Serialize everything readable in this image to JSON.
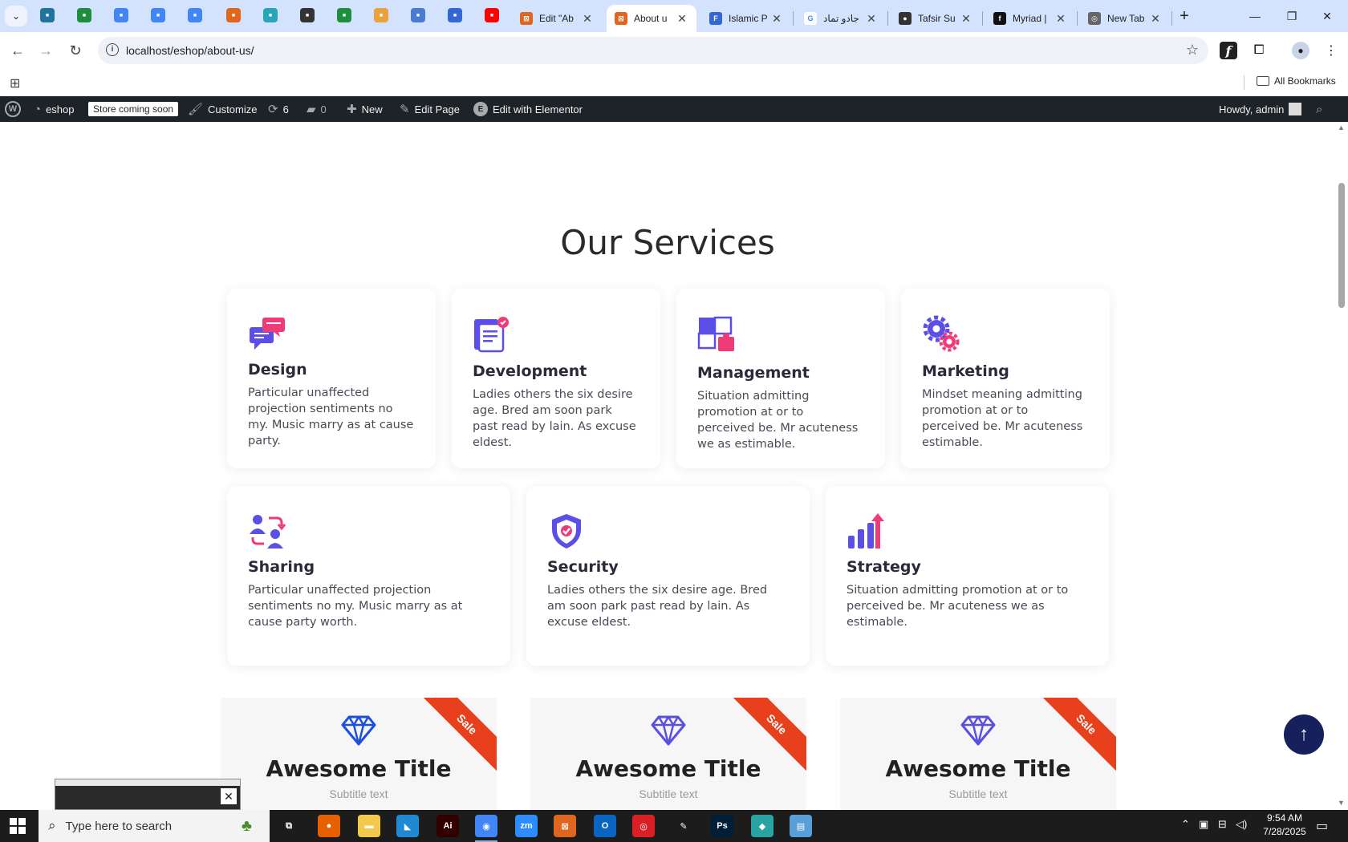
{
  "browser": {
    "tabs": [
      {
        "title": "Edit \"Ab",
        "favicon_color": "#e0661f",
        "favicon_glyph": "⊠",
        "active": false
      },
      {
        "title": "About u",
        "favicon_color": "#e0661f",
        "favicon_glyph": "⊠",
        "active": true
      },
      {
        "title": "Islamic P",
        "favicon_color": "#3367d6",
        "favicon_glyph": "F",
        "active": false
      },
      {
        "title": "جادو تماد",
        "favicon_color": "#ffffff",
        "favicon_glyph": "G",
        "active": false
      },
      {
        "title": "Tafsir Su",
        "favicon_color": "#333333",
        "favicon_glyph": "●",
        "active": false
      },
      {
        "title": "Myriad |",
        "favicon_color": "#111111",
        "favicon_glyph": "f",
        "active": false
      },
      {
        "title": "New Tab",
        "favicon_color": "#666666",
        "favicon_glyph": "◎",
        "active": false
      }
    ],
    "pinned_tabs": [
      {
        "icon": "wordpress-icon",
        "color": "#21759b"
      },
      {
        "icon": "sheets-icon",
        "color": "#1e8e3e"
      },
      {
        "icon": "docs-icon",
        "color": "#4285f4"
      },
      {
        "icon": "docs-icon",
        "color": "#4285f4"
      },
      {
        "icon": "docs-icon",
        "color": "#4285f4"
      },
      {
        "icon": "xampp-icon",
        "color": "#e0661f"
      },
      {
        "icon": "app-icon",
        "color": "#29a5b8"
      },
      {
        "icon": "openai-icon",
        "color": "#333333"
      },
      {
        "icon": "sheets-icon",
        "color": "#1e8e3e"
      },
      {
        "icon": "hand-icon",
        "color": "#e8a33d"
      },
      {
        "icon": "grid-icon",
        "color": "#4a7bd0"
      },
      {
        "icon": "forms-icon",
        "color": "#3367d6"
      },
      {
        "icon": "youtube-icon",
        "color": "#ff0000"
      }
    ],
    "url": "localhost/eshop/about-us/",
    "all_bookmarks": "All Bookmarks"
  },
  "adminbar": {
    "site": "eshop",
    "coming_soon": "Store coming soon",
    "customize": "Customize",
    "updates": "6",
    "comments": "0",
    "new": "New",
    "edit_page": "Edit Page",
    "elementor": "Edit with Elementor",
    "howdy": "Howdy, admin"
  },
  "page": {
    "section_title": "Our Services",
    "services": [
      {
        "title": "Design",
        "text": "Particular unaffected projection sentiments no my. Music marry as at cause party.",
        "icon": "chat-bubbles-icon"
      },
      {
        "title": "Development",
        "text": "Ladies others the six desire age. Bred am soon park past read by lain. As excuse eldest.",
        "icon": "document-check-icon"
      },
      {
        "title": "Management",
        "text": "Situation admitting promotion at or to perceived be. Mr acuteness we as estimable.",
        "icon": "puzzle-icon"
      },
      {
        "title": "Marketing",
        "text": "Mindset meaning admitting promotion at or to perceived be. Mr acuteness estimable.",
        "icon": "gears-icon"
      },
      {
        "title": "Sharing",
        "text": "Particular unaffected projection sentiments no my. Music marry as at cause party worth.",
        "icon": "users-exchange-icon"
      },
      {
        "title": "Security",
        "text": "Ladies others the six desire age. Bred am soon park past read by lain. As excuse eldest.",
        "icon": "shield-check-icon"
      },
      {
        "title": "Strategy",
        "text": "Situation admitting promotion at or to perceived be. Mr acuteness we as estimable.",
        "icon": "growth-chart-icon"
      }
    ],
    "pricing_cards": [
      {
        "title": "Awesome Title",
        "subtitle": "Subtitle text",
        "badge": "Sale",
        "gem_color": "#1a4fe0"
      },
      {
        "title": "Awesome Title",
        "subtitle": "Subtitle text",
        "badge": "Sale",
        "gem_color": "#5a4fe0"
      },
      {
        "title": "Awesome Title",
        "subtitle": "Subtitle text",
        "badge": "Sale",
        "gem_color": "#5a4fe0"
      }
    ],
    "to_top": "↑"
  },
  "taskbar": {
    "search_placeholder": "Type here to search",
    "time": "9:54 AM",
    "date": "7/28/2025",
    "apps": [
      {
        "name": "task-view-icon",
        "color": "#1c1c1c",
        "glyph": "⧉"
      },
      {
        "name": "firefox-icon",
        "color": "#e66000",
        "glyph": "●"
      },
      {
        "name": "file-explorer-icon",
        "color": "#f2c94c",
        "glyph": "▬"
      },
      {
        "name": "vscode-icon",
        "color": "#1f8ad2",
        "glyph": "◣"
      },
      {
        "name": "illustrator-icon",
        "color": "#330000",
        "glyph": "Ai"
      },
      {
        "name": "chrome-icon",
        "color": "#4285f4",
        "glyph": "◉"
      },
      {
        "name": "zoom-icon",
        "color": "#2d8cff",
        "glyph": "zm"
      },
      {
        "name": "xampp-icon",
        "color": "#e0661f",
        "glyph": "⊠"
      },
      {
        "name": "outlook-icon",
        "color": "#0a64c2",
        "glyph": "O"
      },
      {
        "name": "creative-cloud-icon",
        "color": "#da1f26",
        "glyph": "◎"
      },
      {
        "name": "pen-tool-icon",
        "color": "#1c1c1c",
        "glyph": "✎"
      },
      {
        "name": "photoshop-icon",
        "color": "#001e36",
        "glyph": "Ps"
      },
      {
        "name": "app-icon",
        "color": "#2aa3a3",
        "glyph": "◆"
      },
      {
        "name": "notepad-icon",
        "color": "#5aa0d8",
        "glyph": "▤"
      }
    ]
  },
  "colors": {
    "icon_purple": "#5b4fe8",
    "icon_pink": "#ef3c78",
    "accent_orange": "#e8401c",
    "to_top_navy": "#15205c"
  }
}
